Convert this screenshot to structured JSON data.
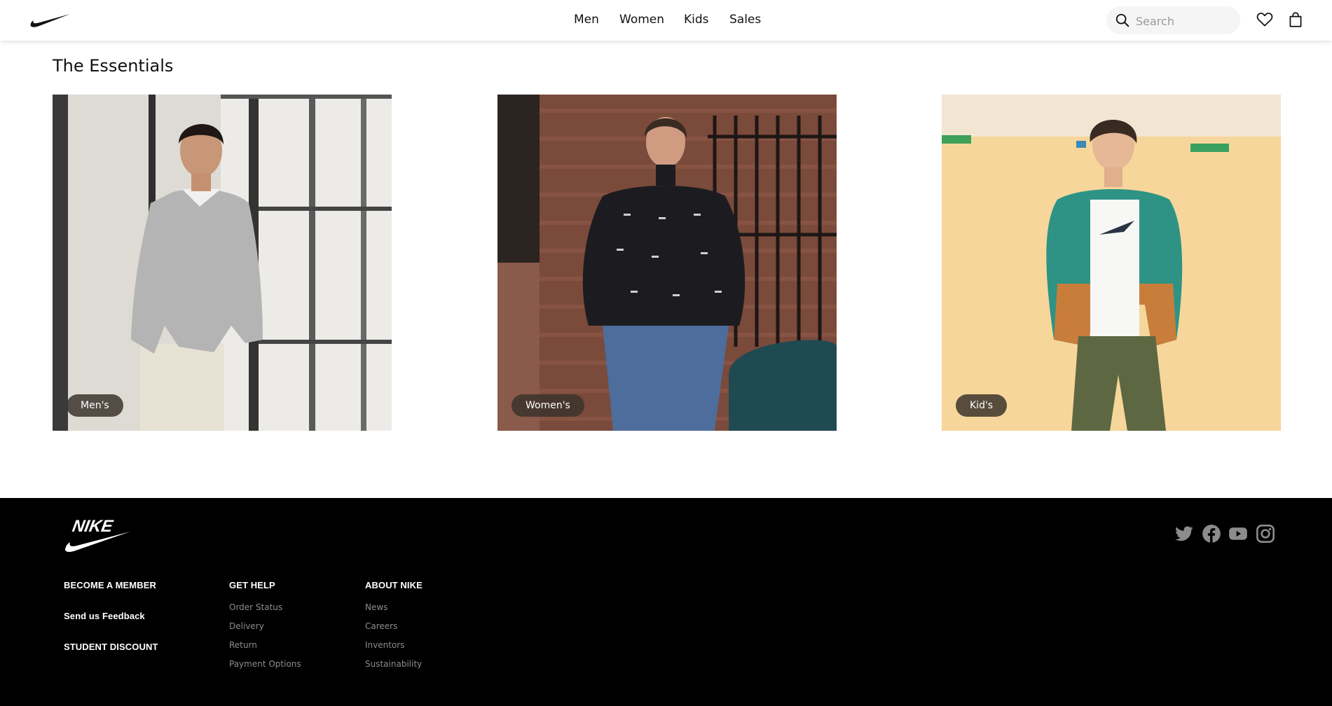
{
  "header": {
    "nav": [
      {
        "label": "Men"
      },
      {
        "label": "Women"
      },
      {
        "label": "Kids"
      },
      {
        "label": "Sales"
      }
    ],
    "search_placeholder": "Search",
    "icons": [
      "nike-swoosh-logo",
      "search-icon",
      "heart-icon",
      "bag-icon"
    ]
  },
  "main": {
    "section_title": "The Essentials",
    "cards": [
      {
        "label": "Men's"
      },
      {
        "label": "Women's"
      },
      {
        "label": "Kid's"
      }
    ]
  },
  "footer": {
    "logo_text": "NIKE",
    "primary_links": [
      {
        "label": "BECOME A MEMBER"
      },
      {
        "label": "Send us Feedback"
      },
      {
        "label": "STUDENT DISCOUNT"
      }
    ],
    "get_help": {
      "heading": "GET HELP",
      "links": [
        "Order Status",
        "Delivery",
        "Return",
        "Payment Options"
      ]
    },
    "about": {
      "heading": "ABOUT NIKE",
      "links": [
        "News",
        "Careers",
        "Inventors",
        "Sustainability"
      ]
    },
    "social_icons": [
      "twitter-icon",
      "facebook-icon",
      "youtube-icon",
      "instagram-icon"
    ]
  },
  "colors": {
    "footer_bg": "#000000",
    "footer_link": "#8c8c8c",
    "label_pill": "#3c342c",
    "search_bg": "#f5f5f5"
  }
}
